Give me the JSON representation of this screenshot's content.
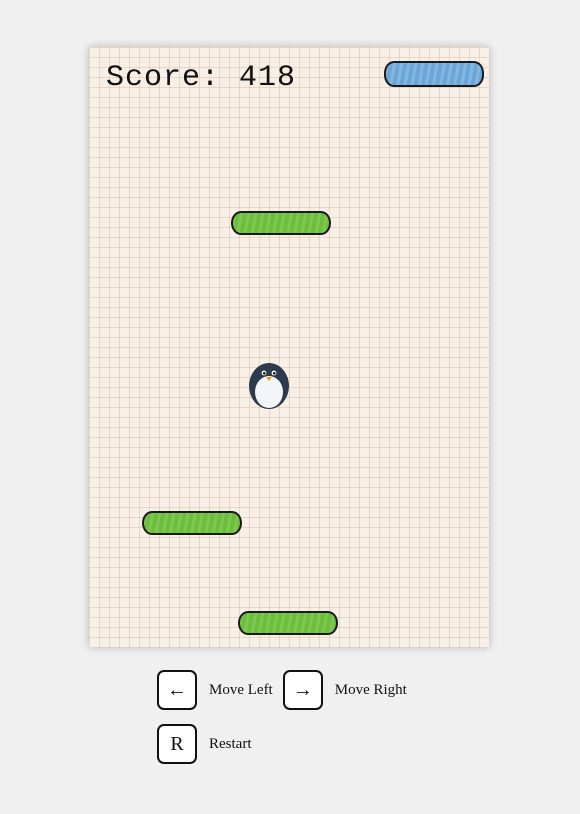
{
  "game": {
    "score_label": "Score: 418",
    "player": "penguin",
    "platforms": [
      {
        "type": "blue",
        "color": "#6aa6d8"
      },
      {
        "type": "green",
        "color": "#6cbf3a"
      },
      {
        "type": "green",
        "color": "#6cbf3a"
      },
      {
        "type": "green",
        "color": "#6cbf3a"
      }
    ]
  },
  "controls": {
    "left_key": "←",
    "left_label": "Move Left",
    "right_key": "→",
    "right_label": "Move Right",
    "restart_key": "R",
    "restart_label": "Restart"
  }
}
